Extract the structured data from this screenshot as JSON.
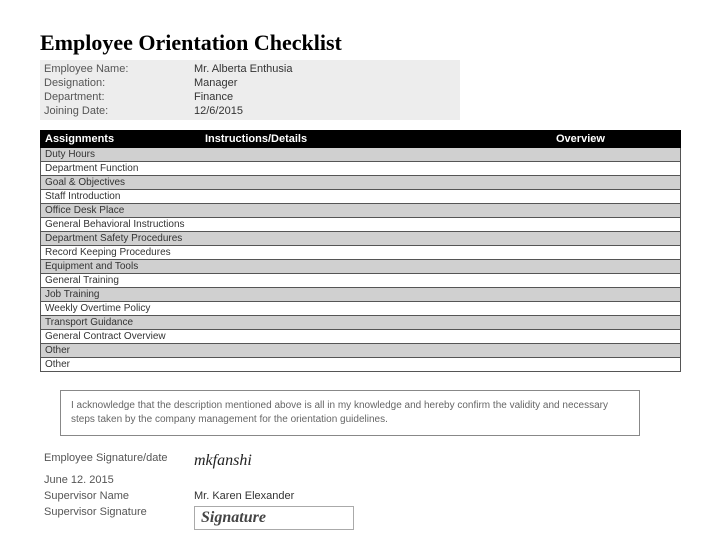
{
  "title": "Employee Orientation Checklist",
  "info": {
    "employee_name_label": "Employee Name:",
    "employee_name": "Mr. Alberta Enthusia",
    "designation_label": "Designation:",
    "designation": "Manager",
    "department_label": "Department:",
    "department": "Finance",
    "joining_date_label": "Joining Date:",
    "joining_date": "12/6/2015"
  },
  "columns": {
    "assignments": "Assignments",
    "instructions": "Instructions/Details",
    "overview": "Overview"
  },
  "rows": [
    "Duty Hours",
    "Department Function",
    "Goal & Objectives",
    "Staff Introduction",
    "Office Desk Place",
    "General Behavioral Instructions",
    "Department Safety Procedures",
    "Record Keeping Procedures",
    "Equipment and Tools",
    "General Training",
    "Job Training",
    "Weekly Overtime Policy",
    "Transport Guidance",
    "General Contract Overview",
    "Other",
    "Other"
  ],
  "acknowledgement": "I acknowledge that the description mentioned above is all in my knowledge and hereby confirm the validity and necessary steps taken by the company management for the orientation guidelines.",
  "signature": {
    "emp_sig_label": "Employee Signature/date",
    "emp_sig_script": "mkfanshi",
    "emp_sig_date": "June 12. 2015",
    "supervisor_name_label": "Supervisor Name",
    "supervisor_name": "Mr. Karen Elexander",
    "supervisor_sig_label": "Supervisor Signature",
    "supervisor_sig_text": "Signature"
  }
}
